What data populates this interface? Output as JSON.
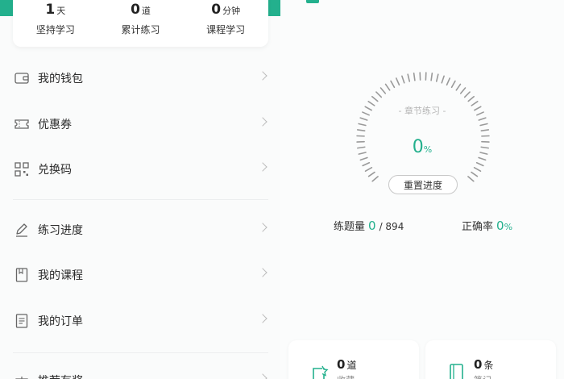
{
  "stats": [
    {
      "value": "1",
      "unit": "天",
      "label": "坚持学习"
    },
    {
      "value": "0",
      "unit": "道",
      "label": "累计练习"
    },
    {
      "value": "0",
      "unit": "分钟",
      "label": "课程学习"
    }
  ],
  "menu": {
    "wallet": "我的钱包",
    "coupons": "优惠券",
    "redeem_code": "兑换码",
    "practice_progress": "练习进度",
    "my_courses": "我的课程",
    "my_orders": "我的订单",
    "partial_item": "推荐有奖"
  },
  "progress": {
    "gauge_title": "- 章节练习 -",
    "percent_value": "0",
    "percent_unit": "%",
    "reset_label": "重置进度",
    "question_count_label": "练题量",
    "question_done": "0",
    "question_total": "/ 894",
    "accuracy_label": "正确率",
    "accuracy_value": "0",
    "accuracy_unit": "%"
  },
  "cards": {
    "favorites": {
      "count": "0",
      "unit": "道",
      "label": "收藏"
    },
    "notes": {
      "count": "0",
      "unit": "条",
      "label": "笔记"
    }
  },
  "colors": {
    "accent": "#23b08d"
  }
}
